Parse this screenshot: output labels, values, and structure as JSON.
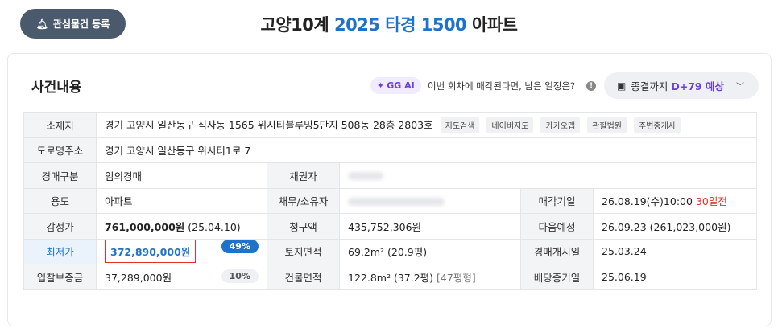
{
  "header": {
    "register_button": "관심물건 등록",
    "title_prefix": "고양10계",
    "title_highlight": "2025 타경 1500",
    "title_suffix": "아파트"
  },
  "card": {
    "title": "사건내용",
    "gg_badge": "GG AI",
    "gg_question": "이번 회차에 매각된다면, 남은 일정은?",
    "dday_prefix": "종결까지",
    "dday_value": "D+79 예상"
  },
  "rows": {
    "address_label": "소재지",
    "address_value": "경기 고양시 일산동구 식사동 1565 위시티블루밍5단지 508동 28층 2803호",
    "address_chips": [
      "지도검색",
      "네이버지도",
      "카카오맵",
      "관할법원",
      "주변중개사"
    ],
    "road_label": "도로명주소",
    "road_value": "경기 고양시 일산동구 위시티1로 7",
    "type_label": "경매구분",
    "type_value": "임의경매",
    "creditor_label": "채권자",
    "usage_label": "용도",
    "usage_value": "아파트",
    "debtor_label": "채무/소유자",
    "sale_date_label": "매각기일",
    "sale_date_value": "26.08.19(수)10:00",
    "sale_date_dday": "30일전",
    "appraisal_label": "감정가",
    "appraisal_value": "761,000,000원",
    "appraisal_date": "(25.04.10)",
    "claim_label": "청구액",
    "claim_value": "435,752,306원",
    "next_label": "다음예정",
    "next_value": "26.09.23 (261,023,000원)",
    "min_label": "최저가",
    "min_value": "372,890,000원",
    "min_pct": "49%",
    "land_label": "토지면적",
    "land_value": "69.2m² (20.9평)",
    "start_label": "경매개시일",
    "start_value": "25.03.24",
    "deposit_label": "입찰보증금",
    "deposit_value": "37,289,000원",
    "deposit_pct": "10%",
    "building_label": "건물면적",
    "building_value": "122.8m² (37.2평)",
    "building_extra": "[47평형]",
    "dividend_label": "배당종기일",
    "dividend_value": "25.06.19"
  }
}
